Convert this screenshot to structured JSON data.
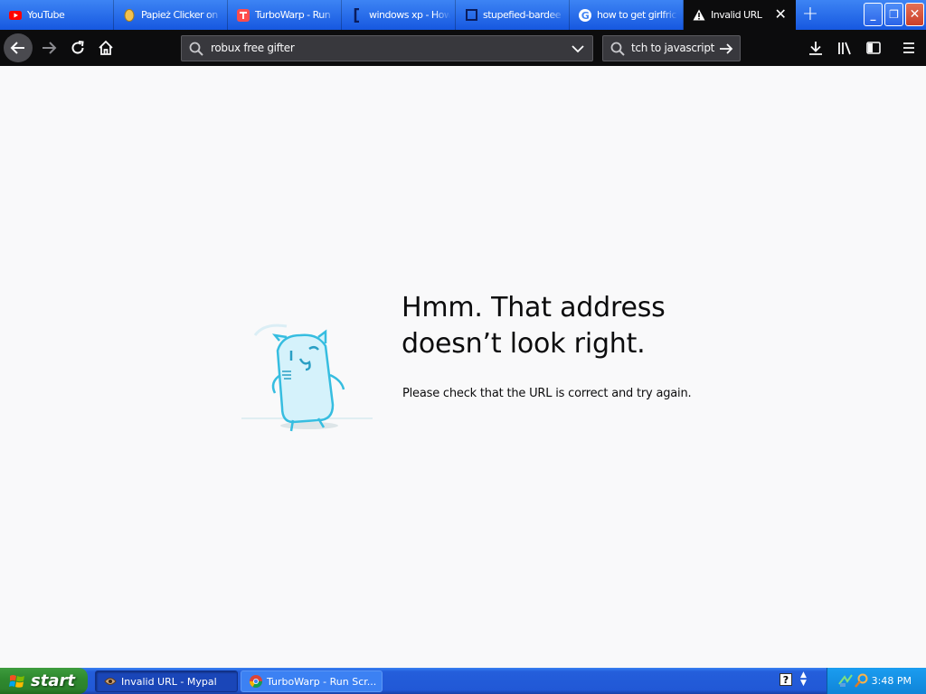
{
  "tabs": [
    {
      "label": "YouTube",
      "icon": "youtube-icon"
    },
    {
      "label": "Papież Clicker on",
      "icon": "papiez-icon"
    },
    {
      "label": "TurboWarp - Run",
      "icon": "turbowarp-icon"
    },
    {
      "label": "windows xp - How",
      "icon": "bracket-icon"
    },
    {
      "label": "stupefied-bardee",
      "icon": "square-icon"
    },
    {
      "label": "how to get girlfric",
      "icon": "google-icon"
    },
    {
      "label": "Invalid URL",
      "icon": "warning-icon",
      "active": true
    }
  ],
  "navbar": {
    "url_value": "robux free gifter",
    "search_value": "tch to javascript"
  },
  "error_page": {
    "title_line1": "Hmm. That address",
    "title_line2": "doesn’t look right.",
    "description": "Please check that the URL is correct and try again."
  },
  "taskbar": {
    "start_label": "start",
    "items": [
      {
        "label": "Invalid URL - Mypal",
        "active": true
      },
      {
        "label": "TurboWarp - Run Scr...",
        "active": false
      }
    ],
    "help_label": "?",
    "clock": "3:48 PM"
  },
  "colors": {
    "tabbar": "#1658e0",
    "navbar": "#0c0c0d",
    "content_bg": "#f9f9fa",
    "taskbar": "#245edb",
    "start_green": "#2f8a2f"
  }
}
